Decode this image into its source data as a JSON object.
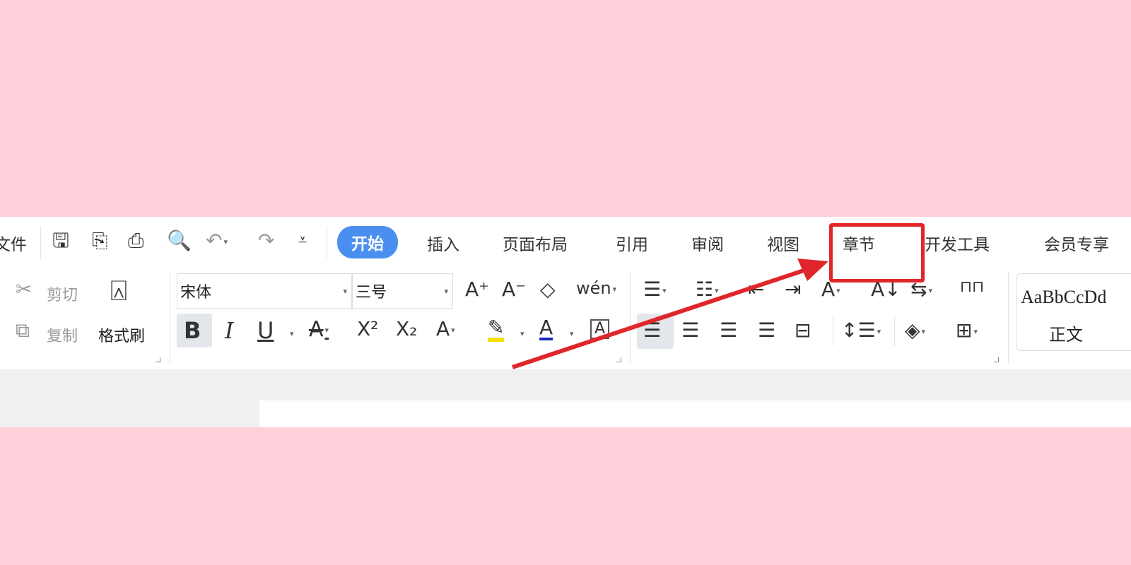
{
  "quick_access": {
    "file_label": "文件",
    "icons": [
      "save-icon",
      "export-icon",
      "print-icon",
      "print-preview-icon",
      "undo-icon",
      "redo-icon",
      "customize-icon"
    ]
  },
  "tabs": [
    {
      "label": "开始",
      "active": true
    },
    {
      "label": "插入"
    },
    {
      "label": "页面布局"
    },
    {
      "label": "引用"
    },
    {
      "label": "审阅"
    },
    {
      "label": "视图"
    },
    {
      "label": "章节"
    },
    {
      "label": "开发工具"
    },
    {
      "label": "会员专享"
    }
  ],
  "clipboard": {
    "cut": "剪切",
    "copy": "复制",
    "format_painter": "格式刷"
  },
  "font": {
    "name": "宋体",
    "size": "三号",
    "bold": "B",
    "italic": "I",
    "underline": "U",
    "superscript": "X²",
    "subscript": "X₂",
    "font_color": "A"
  },
  "styles": {
    "preview": "AaBbCcDd",
    "name": "正文"
  },
  "colors": {
    "accent": "#4a8ff0",
    "background": "#fdd0da",
    "annotation": "#e0262a",
    "highlight": "#f5e100",
    "font_color": "#1a2bb8"
  },
  "annotation": {
    "target": "章节"
  }
}
